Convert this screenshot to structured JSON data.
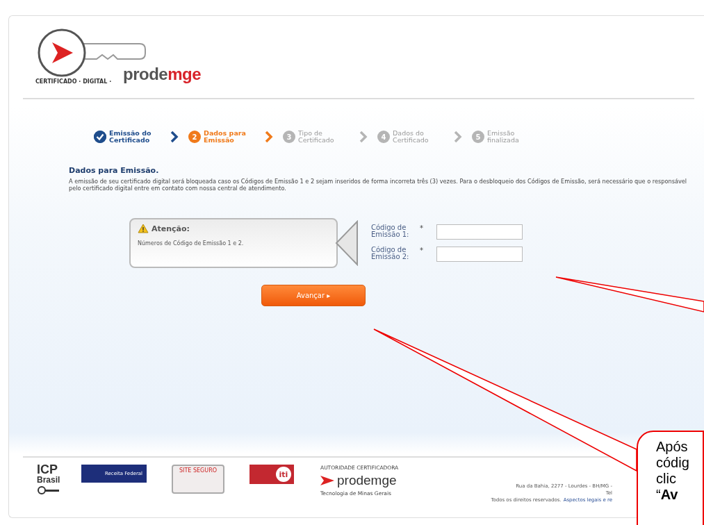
{
  "header": {
    "logo_ring_text": "CERTIFICADO · DIGITAL ·",
    "logo_brand": "prode",
    "logo_brand_accent": "mge"
  },
  "steps": [
    {
      "label": "Emissão do Certificado",
      "completed": true,
      "selected": false
    },
    {
      "number": "2",
      "label": "Dados para Emissão",
      "completed": false,
      "selected": true
    },
    {
      "number": "3",
      "label": "Tipo de Certificado",
      "completed": false,
      "selected": false
    },
    {
      "number": "4",
      "label": "Dados do Certificado",
      "completed": false,
      "selected": false
    },
    {
      "number": "5",
      "label": "Emissão finalizada",
      "completed": false,
      "selected": false
    }
  ],
  "section": {
    "title": "Dados para Emissão.",
    "text": "A emissão de seu certificado digital será bloqueada caso os Códigos de Emissão 1 e 2 sejam inseridos de forma incorreta três (3) vezes. Para o desbloqueio dos Códigos de Emissão, será necessário que o responsável pelo certificado digital entre em contato com nossa central de atendimento."
  },
  "notice": {
    "title": "Atenção:",
    "text": "Números de Código de Emissão 1 e 2."
  },
  "fields": [
    {
      "label": "Código de Emissão 1:",
      "required_mark": "*"
    },
    {
      "label": "Código de Emissão 2:",
      "required_mark": "*"
    }
  ],
  "submit_button": "Avançar ▸",
  "footer": {
    "logos": [
      {
        "kind": "icp",
        "title": "ICP",
        "subtitle": "Brasil"
      },
      {
        "kind": "receita",
        "title": "Receita Federal"
      },
      {
        "kind": "seal",
        "title": "SITE SEGURO"
      },
      {
        "kind": "iti",
        "title": "iti"
      },
      {
        "kind": "prodemge",
        "caption": "AUTORIDADE CERTIFICADORA",
        "title": "prodemge",
        "subtitle": "Tecnologia de Minas Gerais"
      }
    ],
    "address": "Rua da Bahia, 2277 - Lourdes - BH/MG -",
    "phone": "Tel",
    "rights": "Todos os direitos reservados.",
    "legal_link": "Aspectos legais e re"
  },
  "callouts": [
    {
      "lines": [
        "Após",
        "códig",
        "clic",
        "“**Av**"
      ]
    }
  ]
}
